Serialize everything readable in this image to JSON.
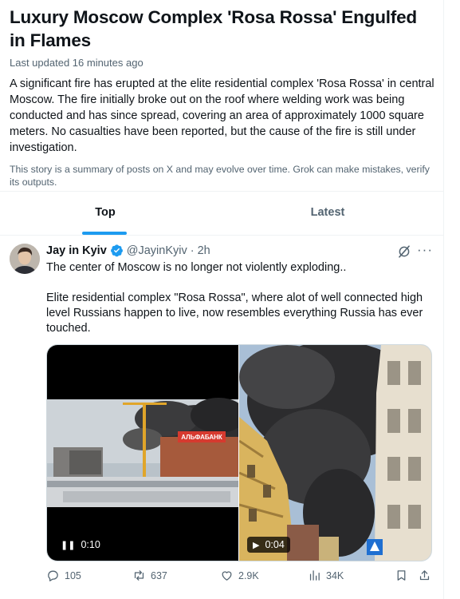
{
  "summary": {
    "title": "Luxury Moscow Complex 'Rosa Rossa' Engulfed in Flames",
    "updated": "Last updated 16 minutes ago",
    "story": "A significant fire has erupted at the elite residential complex 'Rosa Rossa' in central Moscow. The fire initially broke out on the roof where welding work was being conducted and has since spread, covering an area of approximately 1000 square meters. No casualties have been reported, but the cause of the fire is still under investigation.",
    "disclaimer": "This story is a summary of posts on X and may evolve over time. Grok can make mistakes, verify its outputs."
  },
  "tabs": [
    {
      "label": "Top",
      "active": true
    },
    {
      "label": "Latest",
      "active": false
    }
  ],
  "accent_color": "#1d9bf0",
  "tweet": {
    "author_name": "Jay in Kyiv",
    "handle": "@JayinKyiv",
    "separator": "·",
    "time": "2h",
    "verified_icon": "verified-badge-icon",
    "paragraphs": [
      "The center of Moscow is no longer not violently exploding..",
      "Elite residential complex \"Rosa Rossa\", where alot of well connected high level Russians happen to live, now resembles everything Russia has ever touched."
    ],
    "videos": [
      {
        "state_icon": "pause-icon",
        "glyph": "❚❚",
        "duration": "0:10",
        "sign_text": "АЛЬФАБАНК"
      },
      {
        "state_icon": "play-icon",
        "glyph": "▶",
        "duration": "0:04"
      }
    ],
    "stats": {
      "replies": "105",
      "reposts": "637",
      "likes": "2.9K",
      "views": "34K"
    }
  }
}
